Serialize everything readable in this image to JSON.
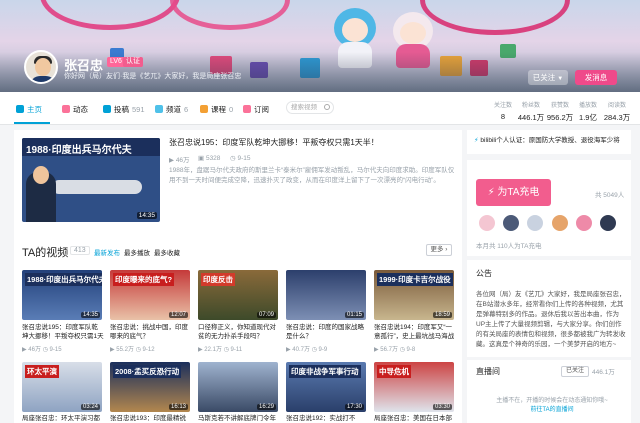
{
  "header": {
    "username": "张召忠",
    "level_badge": "LV6",
    "medal": "认证",
    "sign": "你好网（局）友们·我是《艺兀》大家好，我是局座张召忠",
    "follow_label": "已关注",
    "message_label": "发消息"
  },
  "nav": {
    "items": [
      {
        "label": "主页",
        "count": ""
      },
      {
        "label": "动态",
        "count": ""
      },
      {
        "label": "投稿",
        "count": "591"
      },
      {
        "label": "频道",
        "count": "6"
      },
      {
        "label": "课程",
        "count": "0"
      },
      {
        "label": "订阅",
        "count": ""
      }
    ],
    "search_placeholder": "搜索视频"
  },
  "stats": [
    {
      "label": "关注数",
      "value": "8"
    },
    {
      "label": "粉丝数",
      "value": "446.1万"
    },
    {
      "label": "获赞数",
      "value": "956.2万"
    },
    {
      "label": "播放数",
      "value": "1.9亿"
    },
    {
      "label": "阅读数",
      "value": "284.3万"
    }
  ],
  "rep": {
    "thumb_caption": "1988·印度出兵马尔代夫",
    "duration": "14:35",
    "title": "张召忠说195：印度军队乾坤大挪移！平叛夺权只需1天半！",
    "plays": "46万",
    "danmaku": "5328",
    "date": "9-15",
    "desc": "1988年，盘踞马尔代夫政府的斯里兰卡“泰米尔”雇佣军发动叛乱，马尔代夫向印度求助。印度军队仅用不到一天时间便完成空降，迅速扑灭了政变，从而在印度洋上留下了一次漂亮的“闪电行动”。"
  },
  "videos_section": {
    "title": "TA的视频",
    "count": "413",
    "sort": [
      "最新发布",
      "最多播放",
      "最多收藏"
    ],
    "more_label": "更多"
  },
  "videos": [
    {
      "cap": "1988·印度出兵马尔代夫",
      "dur": "14:35",
      "title": "张召忠说195：印度军队乾坤大挪移！平叛夺权只需1天半",
      "plays": "46万",
      "date": "9-15"
    },
    {
      "cap": "印度曝来的底气?",
      "dur": "12:07",
      "title": "张召忠说：挑战中国，印度哪来的底气？",
      "plays": "55.2万",
      "date": "9-12"
    },
    {
      "cap": "印度反击",
      "dur": "07:09",
      "title": "口径称正义，你知道现代对贫的无力扑杀手段吗？",
      "plays": "22.1万",
      "date": "9-11"
    },
    {
      "cap": "",
      "dur": "01:15",
      "title": "张召忠说：印度的国家战略是什么？",
      "plays": "40.7万",
      "date": "9-9"
    },
    {
      "cap": "1999·印度卡吉尔战役",
      "dur": "18:59",
      "title": "张召忠说194：印度军又“一意孤行”，史上最坑战马海战",
      "plays": "56.7万",
      "date": "9-8"
    },
    {
      "cap": "环太平演",
      "dur": "03:24",
      "title": "局座张召忠：环太平演习都要",
      "plays": "",
      "date": ""
    },
    {
      "cap": "2008·孟买反恐行动",
      "dur": "16:13",
      "title": "张召忠说193：印度最精锐部队",
      "plays": "",
      "date": ""
    },
    {
      "cap": "",
      "dur": "16:29",
      "title": "马斯克若不讲解底牌门令年就",
      "plays": "",
      "date": ""
    },
    {
      "cap": "印度非战争军事行动",
      "dur": "17:30",
      "title": "张召忠说192：实战打不好，",
      "plays": "",
      "date": ""
    },
    {
      "cap": "中导危机",
      "dur": "03:30",
      "title": "局座张召忠：美国在日本部署",
      "plays": "",
      "date": ""
    }
  ],
  "right": {
    "verify": "bilibili个人认证：原国防大学教授、退役海军少将",
    "charge_label": "为TA充电",
    "charge_count": "共 5049人",
    "fans_note": "本月共 110人为TA充电",
    "notice_title": "公告",
    "notice_text": "各位网（局）友《艺兀》大家好，我是局座张召忠，在B站潜水多年，经常看你们上传的各种视频，尤其是弹幕特别多的作品。退休后我以苦出本曲，作为UP主上传了大量视频剪辑，与大家分享。你们创作的有关局座的表情包和视频，很多都被我广为转发收藏。这真是个神奇的乐园，一个美梦开启的地方~",
    "live_title": "直播间",
    "live_follow": "已关注",
    "live_count": "446.1万",
    "live_msg": "主播不在，开播的时候会在动态通知你哦~",
    "live_link": "前往TA的直播间"
  },
  "colors": {
    "accent": "#00a1d6",
    "pink": "#f25d8e"
  }
}
